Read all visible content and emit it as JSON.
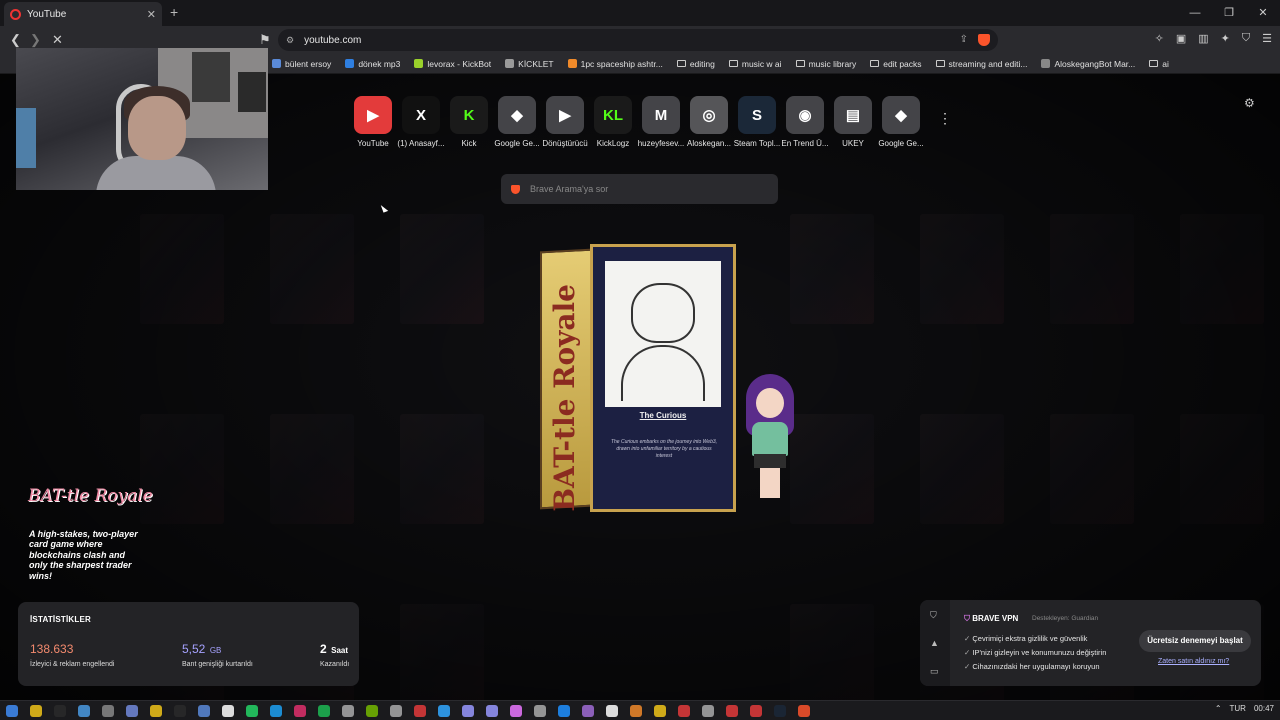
{
  "browser": {
    "tab_title": "YouTube",
    "url": "youtube.com",
    "bookmarks": [
      {
        "label": "bülent ersoy",
        "type": "page",
        "color": "#5a8ad8"
      },
      {
        "label": "dönek mp3",
        "type": "page",
        "color": "#2f7fe0"
      },
      {
        "label": "levorax - KickBot",
        "type": "page",
        "color": "#9ad12b"
      },
      {
        "label": "KİCKLET",
        "type": "page",
        "color": "#9a9a9a"
      },
      {
        "label": "1pc spaceship ashtr...",
        "type": "page",
        "color": "#f08a2a"
      },
      {
        "label": "editing",
        "type": "folder"
      },
      {
        "label": "music w ai",
        "type": "folder"
      },
      {
        "label": "music library",
        "type": "folder"
      },
      {
        "label": "edit packs",
        "type": "folder"
      },
      {
        "label": "streaming and editi...",
        "type": "folder"
      },
      {
        "label": "AloskegangBot Mar...",
        "type": "page",
        "color": "#888888"
      },
      {
        "label": "ai",
        "type": "folder"
      }
    ]
  },
  "top_sites": [
    {
      "label": "YouTube",
      "glyph": "▶",
      "bg": "#e33b3b",
      "icon": "youtube-icon"
    },
    {
      "label": "(1) Anasayf...",
      "glyph": "X",
      "bg": "#111111",
      "icon": "x-icon"
    },
    {
      "label": "Kick",
      "glyph": "K",
      "bg": "#1a1a1a",
      "icon": "kick-icon"
    },
    {
      "label": "Google Ge...",
      "glyph": "◆",
      "bg": "#444448",
      "icon": "gemini-icon"
    },
    {
      "label": "Dönüştürücü",
      "glyph": "▶",
      "bg": "#444448",
      "icon": "converter-icon"
    },
    {
      "label": "KickLogz",
      "glyph": "KL",
      "bg": "#1a1a1a",
      "icon": "kicklogz-icon"
    },
    {
      "label": "huzeyfesev...",
      "glyph": "M",
      "bg": "#444448",
      "icon": "gmail-icon"
    },
    {
      "label": "Aloskegan...",
      "glyph": "◎",
      "bg": "#555558",
      "icon": "globe-icon"
    },
    {
      "label": "Steam Topl...",
      "glyph": "S",
      "bg": "#1b2838",
      "icon": "steam-icon"
    },
    {
      "label": "En Trend Ü...",
      "glyph": "◉",
      "bg": "#444448",
      "icon": "trend-icon"
    },
    {
      "label": "UKEY",
      "glyph": "▤",
      "bg": "#444448",
      "icon": "ukey-icon"
    },
    {
      "label": "Google Ge...",
      "glyph": "◆",
      "bg": "#444448",
      "icon": "gemini-icon"
    }
  ],
  "search": {
    "placeholder": "Brave Arama'ya sor"
  },
  "promo": {
    "logo": "BAT-tle Royale",
    "box_spine": "BAT-tle Royale",
    "card_name": "The Curious",
    "card_text": "The Curious embarks on the journey into Web3, drawn into unfamiliar territory by a cautious interest",
    "tagline": "A high-stakes, two-player card game where blockchains clash and only the sharpest trader wins!"
  },
  "stats": {
    "heading": "İSTATİSTİKLER",
    "items": [
      {
        "value": "138.633",
        "unit": "",
        "label": "İzleyici & reklam engellendi",
        "color": "#f38a6e"
      },
      {
        "value": "5,52",
        "unit": "GB",
        "label": "Bant genişliği kurtarıldı",
        "color": "#a6a2ff"
      },
      {
        "value": "2",
        "unit": "Saat",
        "label": "Kazanıldı",
        "color": "#ffffff"
      }
    ]
  },
  "vpn": {
    "title": "BRAVE VPN",
    "sponsor": "Destekleyen: Guardian",
    "features": [
      "Çevrimiçi ekstra gizlilik ve güvenlik",
      "IP'nizi gizleyin ve konumunuzu değiştirin",
      "Cihazınızdaki her uygulamayı koruyun"
    ],
    "button": "Ücretsiz denemeyi başlat",
    "link": "Zaten satın aldınız mı?"
  },
  "taskbar": {
    "lang": "TUR",
    "time": "00:47",
    "app_colors": [
      "#3a7bd5",
      "#f0c419",
      "#2a2a2a",
      "#4a9ae0",
      "#888888",
      "#7289da",
      "#f0c419",
      "#2a2a2a",
      "#5a8ad8",
      "#ffffff",
      "#25d366",
      "#1da1f2",
      "#e1306c",
      "#1db954",
      "#aaaaaa",
      "#76b900",
      "#aaaaaa",
      "#e33b3b",
      "#31a8ff",
      "#9999ff",
      "#9999ff",
      "#ea77ff",
      "#aaaaaa",
      "#1e90ff",
      "#a06cd5",
      "#ffffff",
      "#f08a2a",
      "#f0c419",
      "#e33b3b",
      "#aaaaaa",
      "#e33b3b",
      "#e33b3b",
      "#1b2838",
      "#fb542b"
    ]
  }
}
